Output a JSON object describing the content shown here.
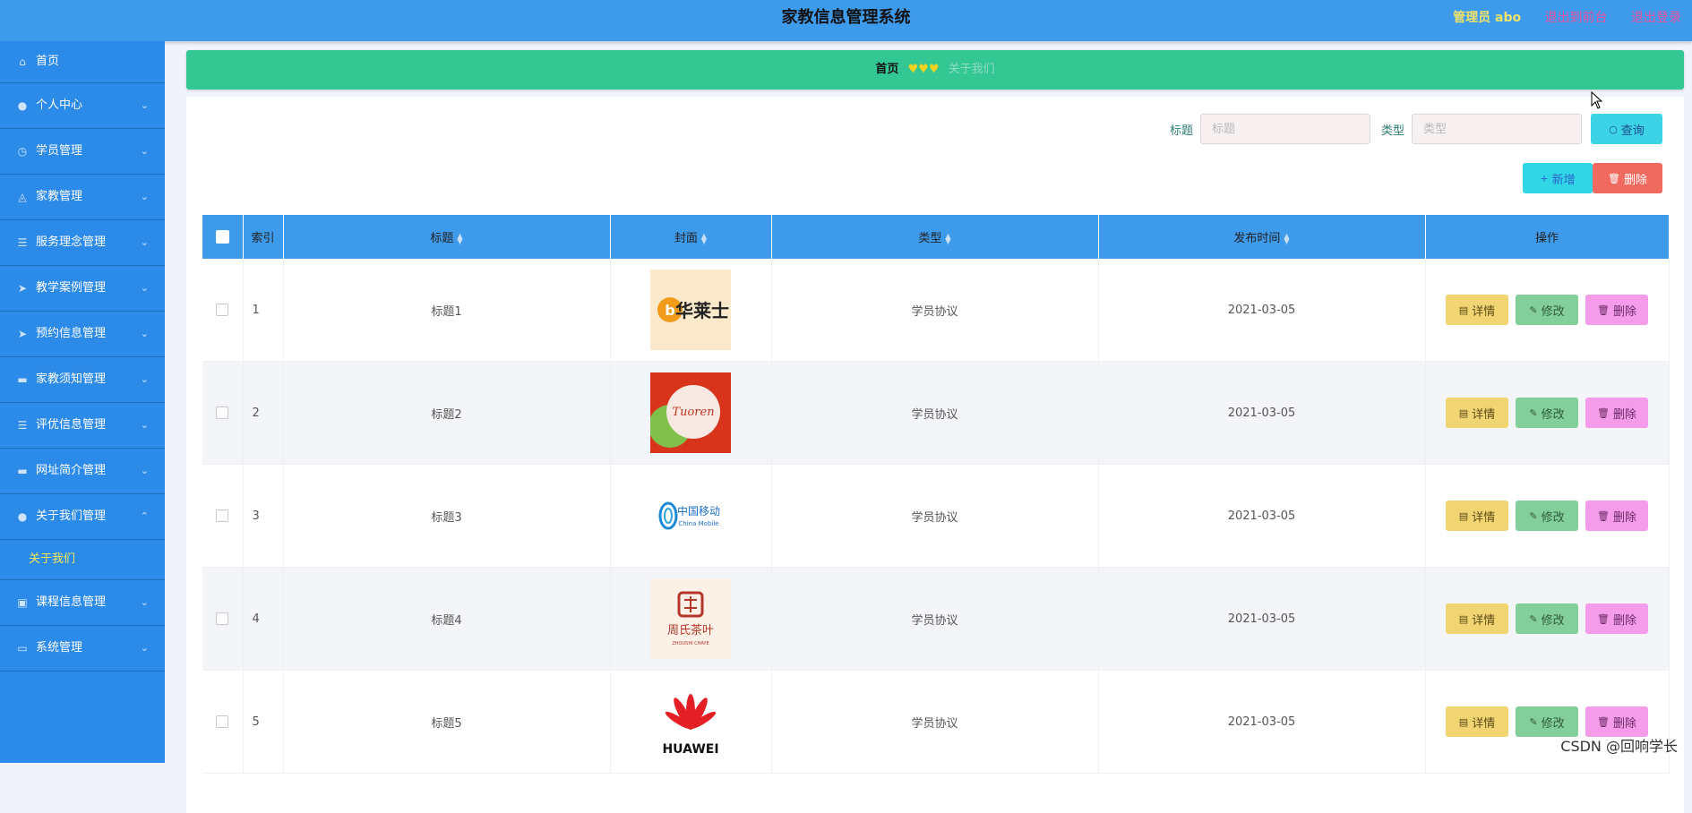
{
  "header": {
    "title": "家教信息管理系统",
    "admin_label": "管理员 abo",
    "back_link": "退出到前台",
    "logout_link": "退出登录"
  },
  "sidebar": {
    "items": [
      {
        "label": "首页",
        "icon": "home-icon"
      },
      {
        "label": "个人中心",
        "icon": "user-icon"
      },
      {
        "label": "学员管理",
        "icon": "clock-icon"
      },
      {
        "label": "家教管理",
        "icon": "bell-off-icon"
      },
      {
        "label": "服务理念管理",
        "icon": "list-icon"
      },
      {
        "label": "教学案例管理",
        "icon": "send-icon"
      },
      {
        "label": "预约信息管理",
        "icon": "send-icon"
      },
      {
        "label": "家教须知管理",
        "icon": "monitor-icon"
      },
      {
        "label": "评优信息管理",
        "icon": "list-icon"
      },
      {
        "label": "网址简介管理",
        "icon": "monitor-icon"
      },
      {
        "label": "关于我们管理",
        "icon": "user-icon"
      },
      {
        "label": "课程信息管理",
        "icon": "picture-icon"
      },
      {
        "label": "系统管理",
        "icon": "chat-icon"
      }
    ],
    "sub_item": "关于我们"
  },
  "breadcrumb": {
    "home": "首页",
    "separator": "♥♥♥",
    "current": "关于我们"
  },
  "search": {
    "title_label": "标题",
    "title_placeholder": "标题",
    "type_label": "类型",
    "type_placeholder": "类型",
    "query_button": "查询"
  },
  "actions": {
    "add_button": "新增",
    "delete_button": "删除"
  },
  "table": {
    "columns": [
      "索引",
      "标题",
      "封面",
      "类型",
      "发布时间",
      "操作"
    ],
    "rows": [
      {
        "index": "1",
        "title": "标题1",
        "cover": "华莱士",
        "type": "学员协议",
        "date": "2021-03-05"
      },
      {
        "index": "2",
        "title": "标题2",
        "cover": "Tuoren",
        "type": "学员协议",
        "date": "2021-03-05"
      },
      {
        "index": "3",
        "title": "标题3",
        "cover": "中国移动",
        "type": "学员协议",
        "date": "2021-03-05"
      },
      {
        "index": "4",
        "title": "标题4",
        "cover": "周氏茶叶",
        "type": "学员协议",
        "date": "2021-03-05"
      },
      {
        "index": "5",
        "title": "标题5",
        "cover": "HUAWEI",
        "type": "学员协议",
        "date": "2021-03-05"
      }
    ],
    "row_buttons": {
      "detail": "详情",
      "edit": "修改",
      "delete": "删除"
    }
  },
  "watermark": "CSDN @回响学长",
  "colors": {
    "header_bg": "#3e9beb",
    "sidebar_bg": "#2c8ae8",
    "breadcrumb_bg": "#33c794",
    "detail_btn": "#f0d572",
    "edit_btn": "#83cf9a",
    "delete_btn": "#f49be9"
  }
}
